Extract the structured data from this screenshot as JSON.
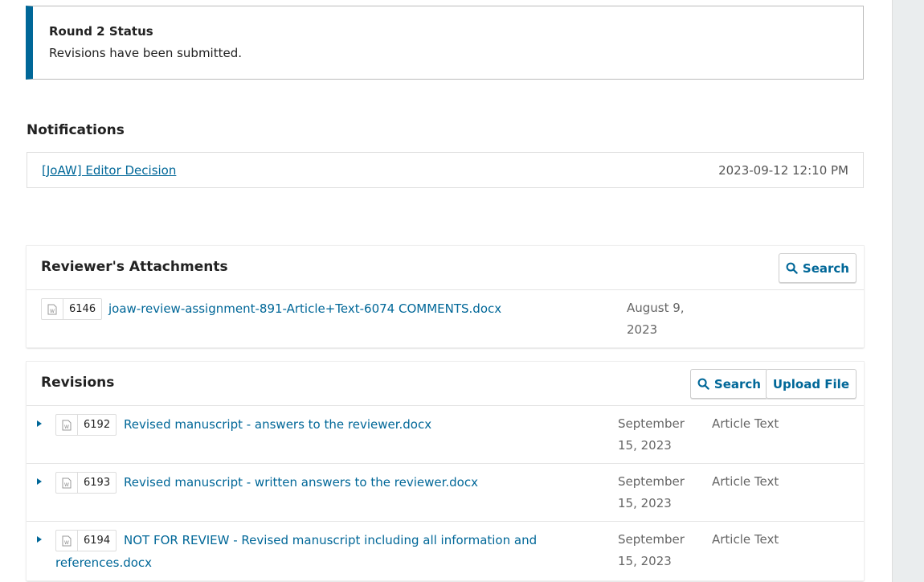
{
  "round_status": {
    "title": "Round 2 Status",
    "text": "Revisions have been submitted."
  },
  "notifications": {
    "heading": "Notifications",
    "items": [
      {
        "label": "[JoAW] Editor Decision",
        "date": "2023-09-12 12:10 PM"
      }
    ]
  },
  "reviewer_attachments": {
    "title": "Reviewer's Attachments",
    "search_label": "Search",
    "files": [
      {
        "id": "6146",
        "name": "joaw-review-assignment-891-Article+Text-6074 COMMENTS.docx",
        "date": "August 9, 2023"
      }
    ]
  },
  "revisions": {
    "title": "Revisions",
    "search_label": "Search",
    "upload_label": "Upload File",
    "files": [
      {
        "id": "6192",
        "name": "Revised manuscript - answers to the reviewer.docx",
        "date": "September 15, 2023",
        "genre": "Article Text"
      },
      {
        "id": "6193",
        "name": "Revised manuscript - written answers to the reviewer.docx",
        "date": "September 15, 2023",
        "genre": "Article Text"
      },
      {
        "id": "6194",
        "name": "NOT FOR REVIEW - Revised manuscript including all information and references.docx",
        "date": "September 15, 2023",
        "genre": "Article Text"
      }
    ]
  },
  "colors": {
    "accent": "#006798",
    "status_bar": "#006798"
  },
  "icons": {
    "search": "search-icon",
    "file": "word-file-icon",
    "expand": "expand-arrow-icon"
  }
}
